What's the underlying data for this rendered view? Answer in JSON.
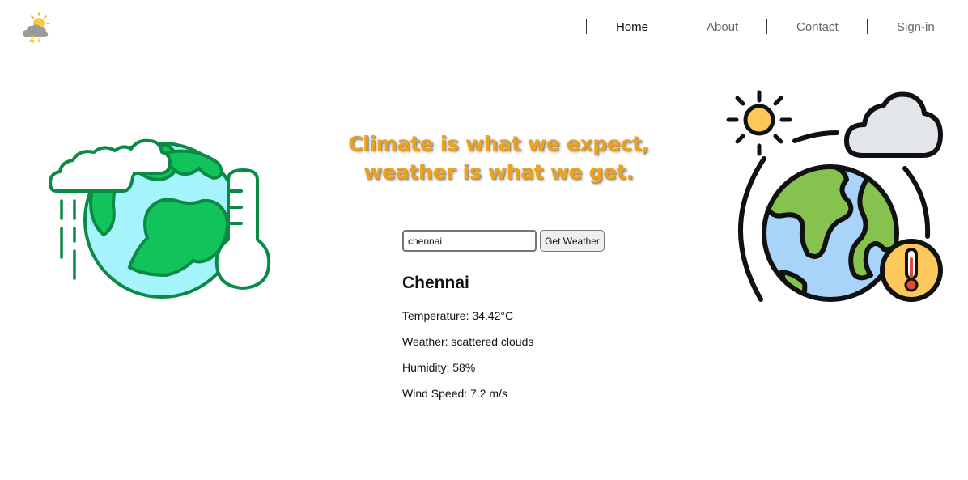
{
  "nav": {
    "items": [
      {
        "label": "Home",
        "active": true
      },
      {
        "label": "About",
        "active": false
      },
      {
        "label": "Contact",
        "active": false
      },
      {
        "label": "Sign-in",
        "active": false
      }
    ]
  },
  "logo": {
    "icon": "sun-cloud-lightning-icon"
  },
  "quote": {
    "line1": "Climate is what we expect,",
    "line2": "weather is what we get."
  },
  "search": {
    "value": "chennai",
    "button_label": "Get Weather"
  },
  "result": {
    "city": "Chennai",
    "temperature": "Temperature: 34.42°C",
    "weather": "Weather: scattered clouds",
    "humidity": "Humidity: 58%",
    "wind": "Wind Speed: 7.2 m/s"
  },
  "illustrations": {
    "left": "earth-cloud-thermometer-icon",
    "right": "earth-sun-cloud-thermometer-icon"
  },
  "colors": {
    "quote": "#eaa21f",
    "earth_green_left": "#12c25a",
    "earth_ocean_left": "#a6f4fb",
    "earth_green_right": "#86c24e",
    "earth_ocean_right": "#a9d4fa",
    "sun": "#fcc85a"
  }
}
